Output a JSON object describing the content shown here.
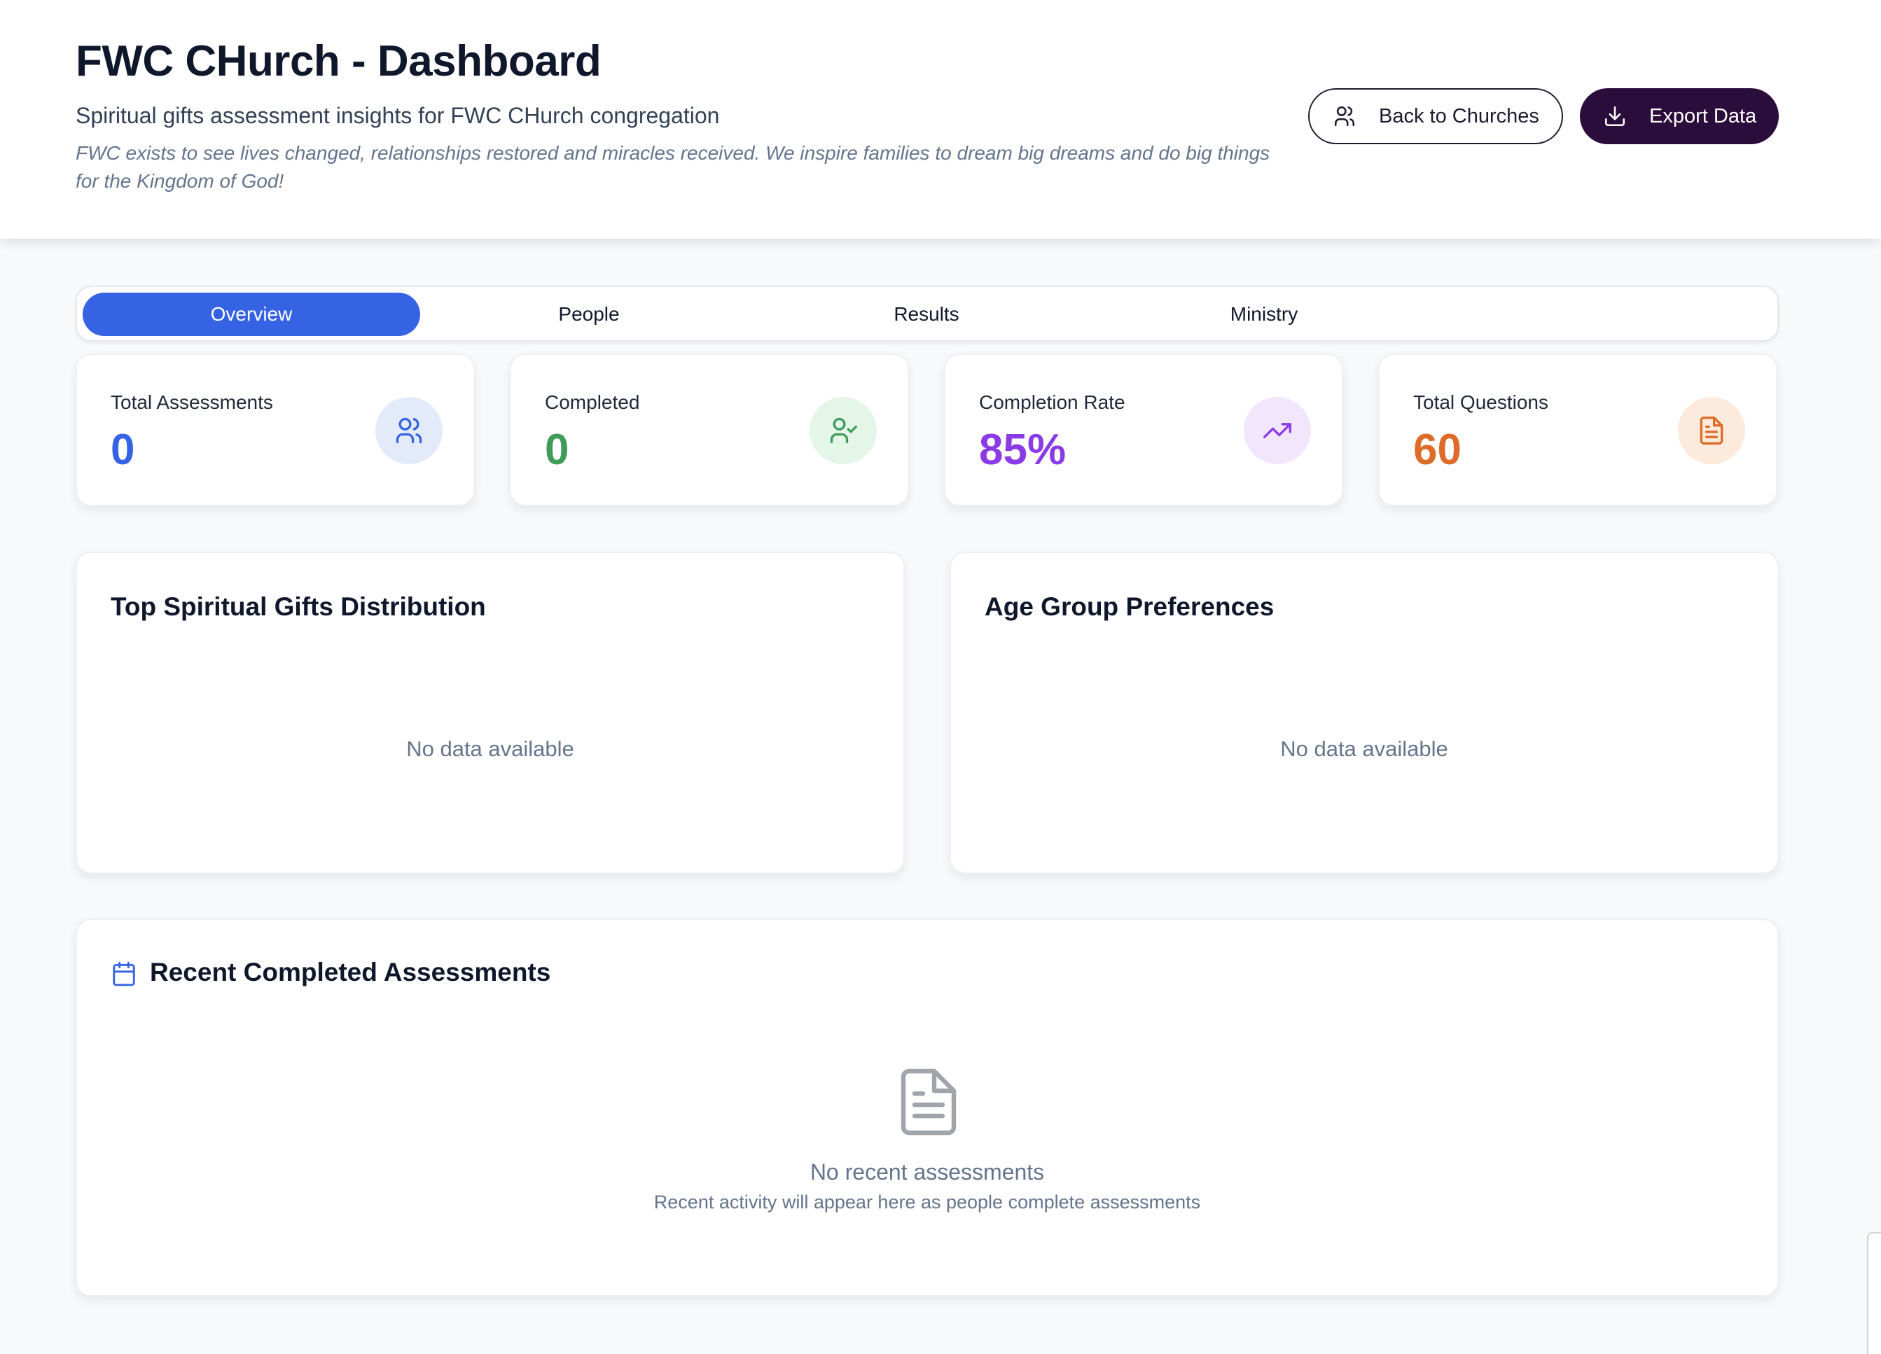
{
  "header": {
    "title": "FWC CHurch - Dashboard",
    "subtitle": "Spiritual gifts assessment insights for FWC CHurch congregation",
    "mission": "FWC exists to see lives changed, relationships restored and miracles received. We inspire families to dream big dreams and do big things for the Kingdom of God!",
    "back_label": "Back to Churches",
    "export_label": "Export Data"
  },
  "tabs": [
    {
      "label": "Overview",
      "active": true
    },
    {
      "label": "People",
      "active": false
    },
    {
      "label": "Results",
      "active": false
    },
    {
      "label": "Ministry",
      "active": false
    }
  ],
  "stats": [
    {
      "label": "Total Assessments",
      "value": "0",
      "color": "#3563e3",
      "icon": "users-icon",
      "icon_bg": "#e3ebfb"
    },
    {
      "label": "Completed",
      "value": "0",
      "color": "#3f9b5a",
      "icon": "user-check-icon",
      "icon_bg": "#e3f6e8"
    },
    {
      "label": "Completion Rate",
      "value": "85%",
      "color": "#8b3be6",
      "icon": "trending-up-icon",
      "icon_bg": "#f1e6fb"
    },
    {
      "label": "Total Questions",
      "value": "60",
      "color": "#dd6b2a",
      "icon": "document-icon",
      "icon_bg": "#fcebdc"
    }
  ],
  "gifts_panel": {
    "title": "Top Spiritual Gifts Distribution",
    "empty": "No data available"
  },
  "age_panel": {
    "title": "Age Group Preferences",
    "empty": "No data available"
  },
  "recent": {
    "title": "Recent Completed Assessments",
    "empty_title": "No recent assessments",
    "empty_sub": "Recent activity will appear here as people complete assessments"
  }
}
